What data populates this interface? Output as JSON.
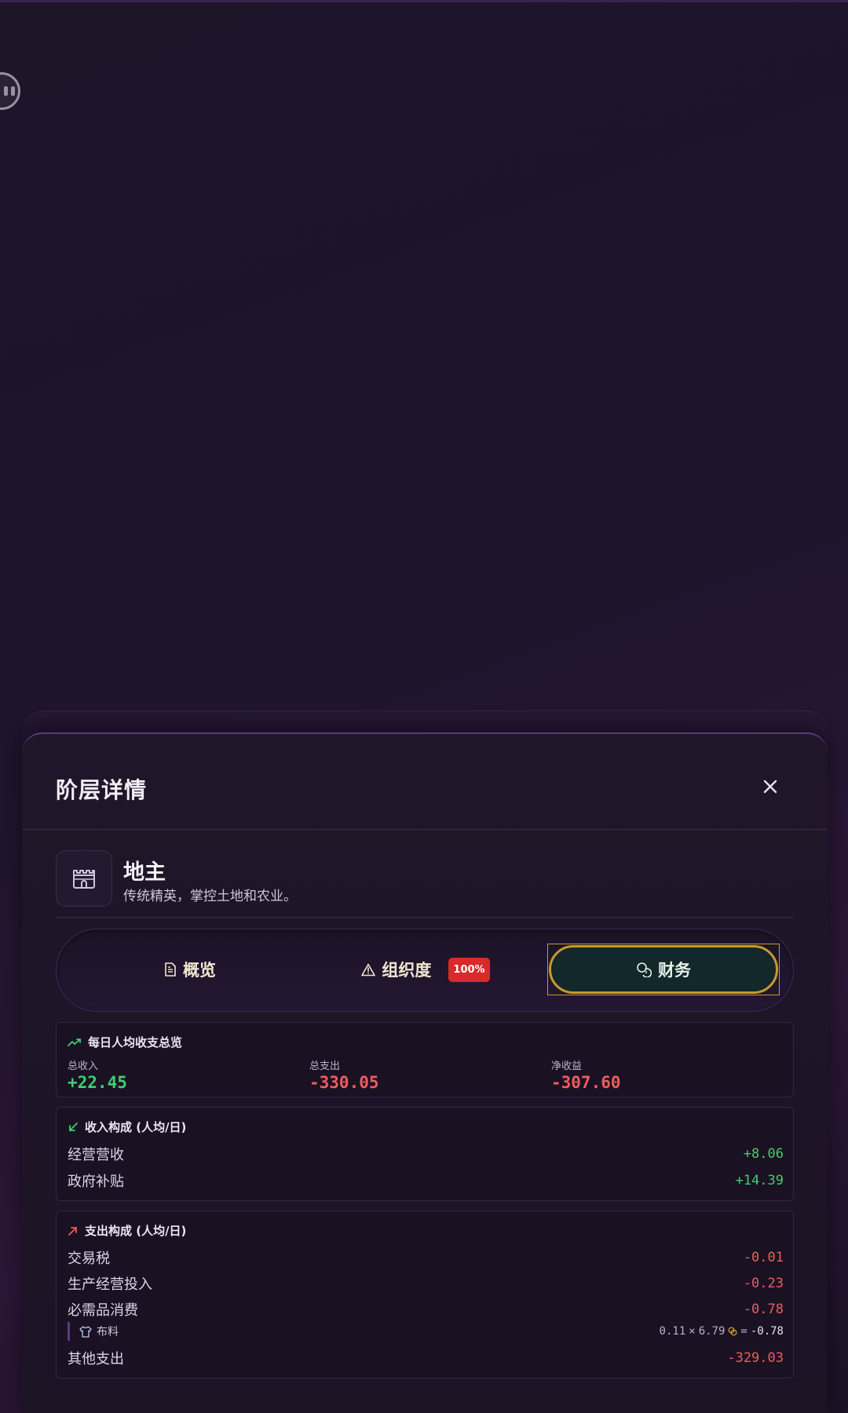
{
  "modal": {
    "title": "阶层详情",
    "class_name": "地主",
    "class_description": "传统精英，掌控土地和农业。"
  },
  "tabs": [
    {
      "label": "概览",
      "icon": "document-icon"
    },
    {
      "label": "组织度",
      "icon": "warning-icon",
      "badge": "100%"
    },
    {
      "label": "财务",
      "icon": "coins-icon",
      "active": true
    }
  ],
  "summary": {
    "title": "每日人均收支总览",
    "total_income_label": "总收入",
    "total_income": "+22.45",
    "total_expense_label": "总支出",
    "total_expense": "-330.05",
    "net_label": "净收益",
    "net": "-307.60"
  },
  "income": {
    "title": "收入构成 (人均/日)",
    "items": [
      {
        "label": "经营营收",
        "value": "+8.06"
      },
      {
        "label": "政府补贴",
        "value": "+14.39"
      }
    ]
  },
  "expense": {
    "title": "支出构成 (人均/日)",
    "items": [
      {
        "label": "交易税",
        "value": "-0.01"
      },
      {
        "label": "生产经营投入",
        "value": "-0.23"
      },
      {
        "label": "必需品消费",
        "value": "-0.78"
      },
      {
        "label": "其他支出",
        "value": "-329.03"
      }
    ],
    "sub_item": {
      "label": "布料",
      "qty": "0.11",
      "times": "×",
      "price": "6.79",
      "equals": "=",
      "result": "-0.78"
    }
  },
  "colors": {
    "accent_gold": "#c79a2b",
    "positive": "#3fcf72",
    "negative": "#ee5d5d",
    "badge_red": "#d92a2a"
  }
}
